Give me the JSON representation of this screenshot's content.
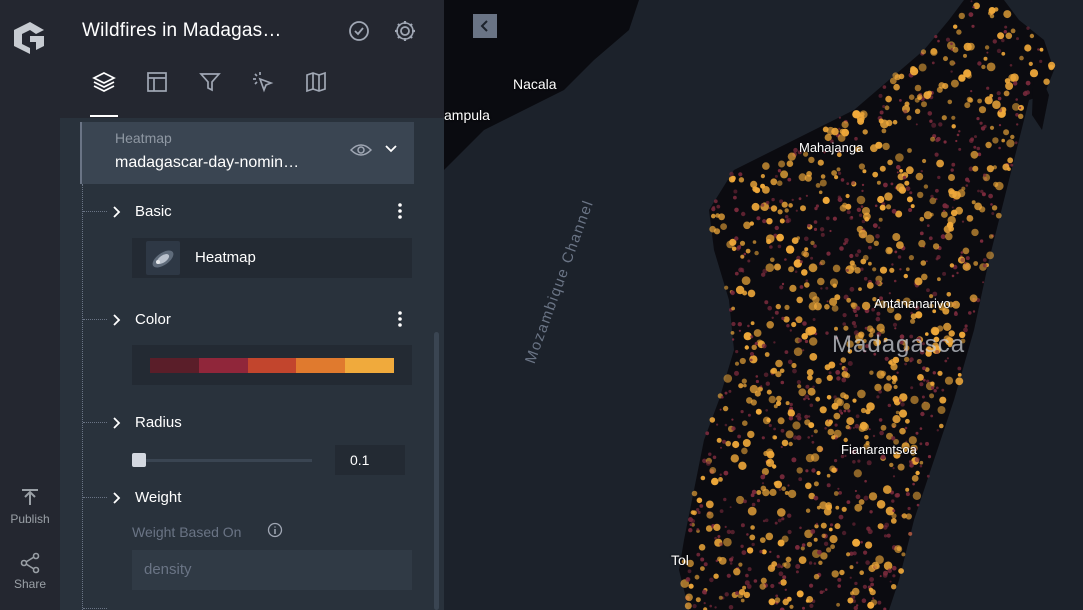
{
  "app": {
    "title": "Wildfires in Madagas…",
    "rail": {
      "publish_label": "Publish",
      "share_label": "Share"
    }
  },
  "panel": {
    "tabs": [
      "layers",
      "interactions",
      "filters",
      "tooltip",
      "basemap"
    ],
    "layer": {
      "type": "Heatmap",
      "name": "madagascar-day-nomin…"
    },
    "sections": {
      "basic": "Basic",
      "visualization": "Heatmap",
      "color": "Color",
      "radius": "Radius",
      "weight": "Weight"
    },
    "radius_value": "0.1",
    "radius_fraction": 0.0,
    "weight_based_on_label": "Weight Based On",
    "weight_field_placeholder": "density",
    "color_ramp": [
      "#5a1e29",
      "#90263a",
      "#c2452d",
      "#e07a2e",
      "#f0aa3c"
    ]
  },
  "map": {
    "labels": {
      "nacala": "Nacala",
      "nampula": "ampula",
      "mahajanga": "Mahajanga",
      "channel": "Mozambique Channel",
      "antananarivo": "Antananarivo",
      "madagascar": "Madagasca",
      "fianarantsoa": "Fianarantsoa",
      "toliara": "Tol"
    },
    "colors": {
      "land": "#0a0b10",
      "water": "#1c222b",
      "fire": "#f0a93a",
      "ember": "#7a2a3c"
    }
  }
}
